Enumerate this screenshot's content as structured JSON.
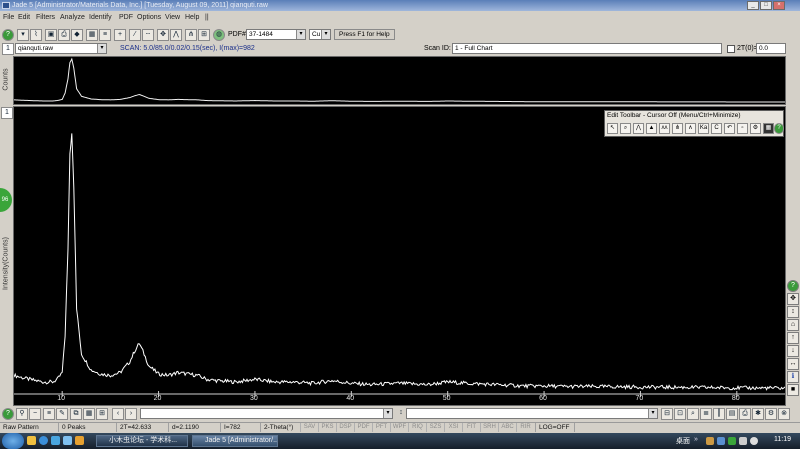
{
  "titlebar": {
    "title": "Jade 5 [Administrator/Materials Data, Inc.]   [Tuesday, August 09, 2011]   qianquti.raw"
  },
  "menu": [
    "File",
    "Edit",
    "Filters",
    "Analyze",
    "Identify",
    "PDF",
    "Options",
    "View",
    "Help",
    "||"
  ],
  "toolbar": {
    "pdf_label": "PDF#",
    "pdf_value": "37-1484",
    "element_value": "Cu",
    "help_text": "Press F1 for Help"
  },
  "info": {
    "file_value": "qianquti.raw",
    "scan_text": "SCAN: 5.0/85.0/0.02/0.15(sec), I(max)=982",
    "scan_id_label": "Scan ID:",
    "scan_id_value": "1 - Full Chart",
    "theta0_label": "2T(0)=",
    "theta0_value": "0.0"
  },
  "overview": {
    "ylabel": "Counts"
  },
  "main": {
    "ylabel": "Intensity(Counts)",
    "xlabel": "2-Theta(°)",
    "side_badge": "96"
  },
  "edit_toolbar": {
    "title": "Edit Toolbar - Cursor Off (Menu/Ctrl+Minimize)"
  },
  "status": {
    "pattern": "Raw Pattern",
    "peaks": "0 Peaks",
    "two_theta": "2T=42.633",
    "d_value": "d=2.1190",
    "intensity": "I=782",
    "axis": "2-Theta(°)",
    "flags": [
      "SAV",
      "PKS",
      "DSP",
      "PDF",
      "PFT",
      "WPF",
      "RIQ",
      "SZS",
      "XSI",
      "FIT",
      "SRH",
      "ABC",
      "RIR"
    ],
    "log": "LOG=OFF"
  },
  "taskbar": {
    "items": [
      "小木虫论坛 - 学术科...",
      "Jade 5 [Administrator/..."
    ],
    "tray_label": "桌面",
    "clock": "11:19"
  },
  "chart_data": {
    "type": "line",
    "title": "",
    "xlabel": "2-Theta(°)",
    "ylabel": "Intensity(Counts)",
    "xlim": [
      5,
      85
    ],
    "ylim": [
      0,
      982
    ],
    "xticks": [
      10,
      20,
      30,
      40,
      50,
      60,
      70,
      80
    ],
    "series": [
      {
        "x": [
          5,
          6,
          7,
          8,
          9,
          9.5,
          10,
          10.3,
          10.6,
          10.8,
          11,
          11.2,
          11.5,
          12,
          13,
          14,
          15,
          16,
          17,
          17.5,
          18,
          18.5,
          19,
          20,
          21,
          22,
          23,
          24,
          25,
          26,
          28,
          30,
          32,
          34,
          36,
          38,
          40,
          42,
          45,
          48,
          50,
          52,
          55,
          58,
          60,
          62,
          65,
          70,
          75,
          80,
          85
        ],
        "y": [
          70,
          60,
          52,
          45,
          45,
          55,
          80,
          220,
          540,
          900,
          982,
          780,
          320,
          150,
          90,
          75,
          70,
          80,
          120,
          160,
          190,
          150,
          105,
          75,
          70,
          80,
          75,
          70,
          55,
          50,
          45,
          55,
          45,
          45,
          40,
          50,
          40,
          35,
          40,
          35,
          45,
          40,
          35,
          30,
          30,
          28,
          28,
          26,
          25,
          23,
          22
        ]
      }
    ]
  },
  "right_toolbar": [
    "?",
    "+",
    "=",
    "^",
    "arrow-up",
    "arrow-down",
    "left-right",
    "info",
    "stop"
  ]
}
